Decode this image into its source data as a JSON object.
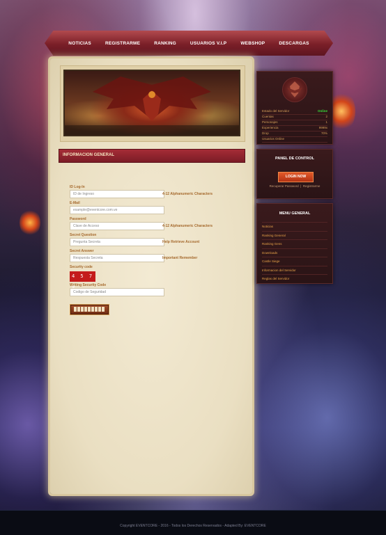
{
  "nav": {
    "items": [
      "NOTICIAS",
      "REGISTRARME",
      "RANKING",
      "USUARIOS V.I.P",
      "WEBSHOP",
      "DESCARGAS"
    ]
  },
  "main": {
    "section_title": "INFORMACION GENERAL",
    "form": {
      "id_label": "ID Log-In",
      "id_placeholder": "ID de Ingreso",
      "id_hint": "4-12 Alphanumeric Characters",
      "email_label": "E-Mail",
      "email_placeholder": "example@eventcore.com.ve",
      "password_label": "Password",
      "password_placeholder": "Clave de Acceso",
      "password_hint": "4-12 Alphanumeric Characters",
      "question_label": "Secret Question",
      "question_placeholder": "Pregunta Secreta",
      "question_hint": "Help Retrieve Account",
      "answer_label": "Secret Answer",
      "answer_placeholder": "Respuesta Secreta",
      "answer_hint": "Important Remember",
      "code_label": "Security code",
      "code_value": "4 5 7 9",
      "writing_label": "Writing Security Code",
      "writing_placeholder": "Codigo de Seguridad"
    }
  },
  "status": {
    "rows": [
      {
        "label": "Estado del Servidor",
        "value": "Online"
      },
      {
        "label": "Cuentas",
        "value": "2"
      },
      {
        "label": "Personajes",
        "value": "1"
      },
      {
        "label": "Experiencia",
        "value": "9999x"
      },
      {
        "label": "Drop",
        "value": "70%"
      },
      {
        "label": "Usuarios Online",
        "value": ""
      }
    ],
    "online_color": "#37e03a"
  },
  "panel": {
    "title": "PANEL DE CONTROL",
    "login_label": "LOGIN NOW",
    "recover_label": "Recuperar Password",
    "separator": "|",
    "register_label": "Registrarme"
  },
  "menu": {
    "title": "MENU GENERAL",
    "items": [
      "Noticias",
      "Ranking General",
      "Ranking Gens",
      "Downloads",
      "Castle Siege",
      "Informacion del Servidor",
      "Reglas del Servidor"
    ]
  },
  "footer": {
    "text": "Copyright EVENTCORE - 2016 - Todos los Derechos Reservados - Adapted By: EVENTCORE"
  },
  "colors": {
    "accent_red": "#8f2430",
    "label_brown": "#a5692d",
    "menu_orange": "#e7a248"
  },
  "icons": [
    "guild-emblem-icon",
    "banner-dragon-image"
  ]
}
